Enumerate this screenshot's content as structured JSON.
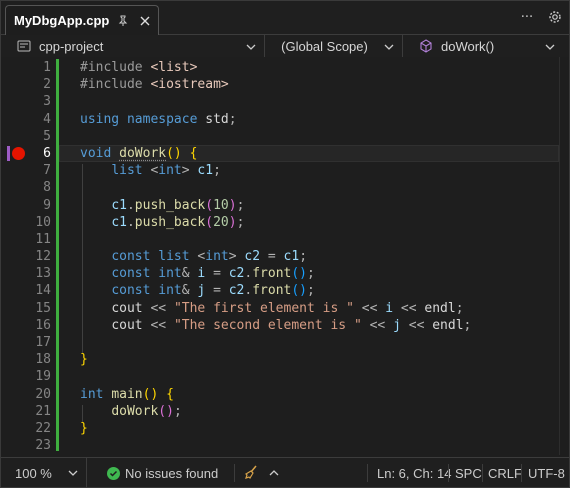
{
  "tab": {
    "title": "MyDbgApp.cpp",
    "pin_icon": "pin-icon",
    "close_icon": "close-icon"
  },
  "toolbar": {
    "overflow_label": "···",
    "settings_icon": "gear-icon"
  },
  "navbar": {
    "project": "cpp-project",
    "scope": "(Global Scope)",
    "member": "doWork()"
  },
  "editor": {
    "current_line": 6,
    "breakpoint_line": 6,
    "lines": [
      {
        "n": "1",
        "tokens": [
          [
            "pp",
            "#include "
          ],
          [
            "inc",
            "<list>"
          ]
        ]
      },
      {
        "n": "2",
        "tokens": [
          [
            "pp",
            "#include "
          ],
          [
            "inc",
            "<iostream>"
          ]
        ]
      },
      {
        "n": "3",
        "tokens": []
      },
      {
        "n": "4",
        "tokens": [
          [
            "kw",
            "using"
          ],
          [
            "tx",
            " "
          ],
          [
            "kw",
            "namespace"
          ],
          [
            "tx",
            " "
          ],
          [
            "ns",
            "std"
          ],
          [
            "op",
            ";"
          ]
        ]
      },
      {
        "n": "5",
        "tokens": []
      },
      {
        "n": "6",
        "tokens": [
          [
            "kw",
            "void"
          ],
          [
            "tx",
            " "
          ],
          [
            "fn squig",
            "doWork"
          ],
          [
            "paren1",
            "()"
          ],
          [
            "tx",
            " "
          ],
          [
            "paren1",
            "{"
          ]
        ]
      },
      {
        "n": "7",
        "tokens": [
          [
            "tx",
            "    "
          ],
          [
            "kw",
            "list"
          ],
          [
            "tx",
            " "
          ],
          [
            "op",
            "<"
          ],
          [
            "kw",
            "int"
          ],
          [
            "op",
            ">"
          ],
          [
            "tx",
            " "
          ],
          [
            "var",
            "c1"
          ],
          [
            "op",
            ";"
          ]
        ]
      },
      {
        "n": "8",
        "tokens": []
      },
      {
        "n": "9",
        "tokens": [
          [
            "tx",
            "    "
          ],
          [
            "var",
            "c1"
          ],
          [
            "op",
            "."
          ],
          [
            "fn",
            "push_back"
          ],
          [
            "paren2",
            "("
          ],
          [
            "num",
            "10"
          ],
          [
            "paren2",
            ")"
          ],
          [
            "op",
            ";"
          ]
        ]
      },
      {
        "n": "10",
        "tokens": [
          [
            "tx",
            "    "
          ],
          [
            "var",
            "c1"
          ],
          [
            "op",
            "."
          ],
          [
            "fn",
            "push_back"
          ],
          [
            "paren2",
            "("
          ],
          [
            "num",
            "20"
          ],
          [
            "paren2",
            ")"
          ],
          [
            "op",
            ";"
          ]
        ]
      },
      {
        "n": "11",
        "tokens": []
      },
      {
        "n": "12",
        "tokens": [
          [
            "tx",
            "    "
          ],
          [
            "kw",
            "const"
          ],
          [
            "tx",
            " "
          ],
          [
            "kw",
            "list"
          ],
          [
            "tx",
            " "
          ],
          [
            "op",
            "<"
          ],
          [
            "kw",
            "int"
          ],
          [
            "op",
            ">"
          ],
          [
            "tx",
            " "
          ],
          [
            "var",
            "c2"
          ],
          [
            "tx",
            " "
          ],
          [
            "op",
            "="
          ],
          [
            "tx",
            " "
          ],
          [
            "var",
            "c1"
          ],
          [
            "op",
            ";"
          ]
        ]
      },
      {
        "n": "13",
        "tokens": [
          [
            "tx",
            "    "
          ],
          [
            "kw",
            "const"
          ],
          [
            "tx",
            " "
          ],
          [
            "kw",
            "int"
          ],
          [
            "op",
            "&"
          ],
          [
            "tx",
            " "
          ],
          [
            "var",
            "i"
          ],
          [
            "tx",
            " "
          ],
          [
            "op",
            "="
          ],
          [
            "tx",
            " "
          ],
          [
            "var",
            "c2"
          ],
          [
            "op",
            "."
          ],
          [
            "fn",
            "front"
          ],
          [
            "paren3",
            "()"
          ],
          [
            "op",
            ";"
          ]
        ]
      },
      {
        "n": "14",
        "tokens": [
          [
            "tx",
            "    "
          ],
          [
            "kw",
            "const"
          ],
          [
            "tx",
            " "
          ],
          [
            "kw",
            "int"
          ],
          [
            "op",
            "&"
          ],
          [
            "tx",
            " "
          ],
          [
            "var",
            "j"
          ],
          [
            "tx",
            " "
          ],
          [
            "op",
            "="
          ],
          [
            "tx",
            " "
          ],
          [
            "var",
            "c2"
          ],
          [
            "op",
            "."
          ],
          [
            "fn",
            "front"
          ],
          [
            "paren3",
            "()"
          ],
          [
            "op",
            ";"
          ]
        ]
      },
      {
        "n": "15",
        "tokens": [
          [
            "tx",
            "    "
          ],
          [
            "ns",
            "cout"
          ],
          [
            "tx",
            " "
          ],
          [
            "op",
            "<<"
          ],
          [
            "tx",
            " "
          ],
          [
            "str",
            "\"The first element is \""
          ],
          [
            "tx",
            " "
          ],
          [
            "op",
            "<<"
          ],
          [
            "tx",
            " "
          ],
          [
            "var",
            "i"
          ],
          [
            "tx",
            " "
          ],
          [
            "op",
            "<<"
          ],
          [
            "tx",
            " "
          ],
          [
            "ns",
            "endl"
          ],
          [
            "op",
            ";"
          ]
        ]
      },
      {
        "n": "16",
        "tokens": [
          [
            "tx",
            "    "
          ],
          [
            "ns",
            "cout"
          ],
          [
            "tx",
            " "
          ],
          [
            "op",
            "<<"
          ],
          [
            "tx",
            " "
          ],
          [
            "str",
            "\"The second element is \""
          ],
          [
            "tx",
            " "
          ],
          [
            "op",
            "<<"
          ],
          [
            "tx",
            " "
          ],
          [
            "var",
            "j"
          ],
          [
            "tx",
            " "
          ],
          [
            "op",
            "<<"
          ],
          [
            "tx",
            " "
          ],
          [
            "ns",
            "endl"
          ],
          [
            "op",
            ";"
          ]
        ]
      },
      {
        "n": "17",
        "tokens": []
      },
      {
        "n": "18",
        "tokens": [
          [
            "paren1",
            "}"
          ]
        ]
      },
      {
        "n": "19",
        "tokens": []
      },
      {
        "n": "20",
        "tokens": [
          [
            "kw",
            "int"
          ],
          [
            "tx",
            " "
          ],
          [
            "fn",
            "main"
          ],
          [
            "paren1",
            "()"
          ],
          [
            "tx",
            " "
          ],
          [
            "paren1",
            "{"
          ]
        ]
      },
      {
        "n": "21",
        "tokens": [
          [
            "tx",
            "    "
          ],
          [
            "fn",
            "doWork"
          ],
          [
            "paren2",
            "()"
          ],
          [
            "op",
            ";"
          ]
        ]
      },
      {
        "n": "22",
        "tokens": [
          [
            "paren1",
            "}"
          ]
        ]
      },
      {
        "n": "23",
        "tokens": []
      }
    ]
  },
  "status": {
    "zoom": "100 %",
    "issues": "No issues found",
    "position": "Ln: 6, Ch: 14",
    "indent": "SPC",
    "line_ending": "CRLF",
    "encoding": "UTF-8"
  },
  "colors": {
    "breakpoint": "#e51400",
    "change_bar": "#3fae3f",
    "ok": "#3fb950",
    "keyword": "#569cd6",
    "function": "#dcdcaa",
    "string": "#d69d85",
    "variable": "#9cdcfe"
  }
}
